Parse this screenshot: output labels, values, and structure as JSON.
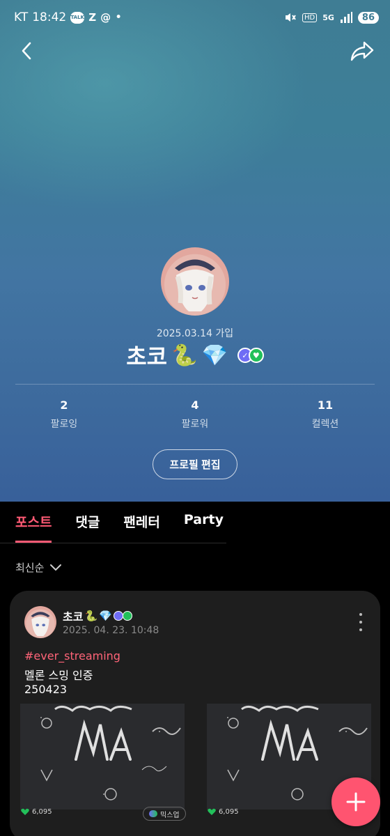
{
  "status_bar": {
    "carrier": "KT",
    "time": "18:42",
    "talk_badge": "TALK",
    "hd": "HD",
    "network": "5G",
    "battery": "86"
  },
  "nav": {
    "back_icon": "chevron-left-icon",
    "share_icon": "share-arrow-icon"
  },
  "profile": {
    "joined": "2025.03.14 가입",
    "name": "초코",
    "name_emojis": [
      "🐍",
      "💎"
    ],
    "badges": [
      "#6f6cf5",
      "#22c05a"
    ],
    "stats": [
      {
        "value": "2",
        "label": "팔로잉"
      },
      {
        "value": "4",
        "label": "팔로워"
      },
      {
        "value": "11",
        "label": "컬렉션"
      }
    ],
    "edit_button": "프로필 편집"
  },
  "tabs": [
    {
      "label": "포스트",
      "active": true
    },
    {
      "label": "댓글",
      "active": false
    },
    {
      "label": "팬레터",
      "active": false
    },
    {
      "label": "Party",
      "active": false
    }
  ],
  "sort": {
    "label": "최신순"
  },
  "post": {
    "author": "초코",
    "author_emojis": [
      "🐍",
      "💎"
    ],
    "date": "2025. 04. 23. 10:48",
    "hashtag": "#ever_streaming",
    "line1": "멜론 스밍 인증",
    "line2": "250423",
    "likes_left": "6,095",
    "likes_right": "6,095",
    "mix_label": "믹스업"
  },
  "colors": {
    "accent": "#ff5a74",
    "background": "#000000",
    "card": "#1e1e1e"
  }
}
